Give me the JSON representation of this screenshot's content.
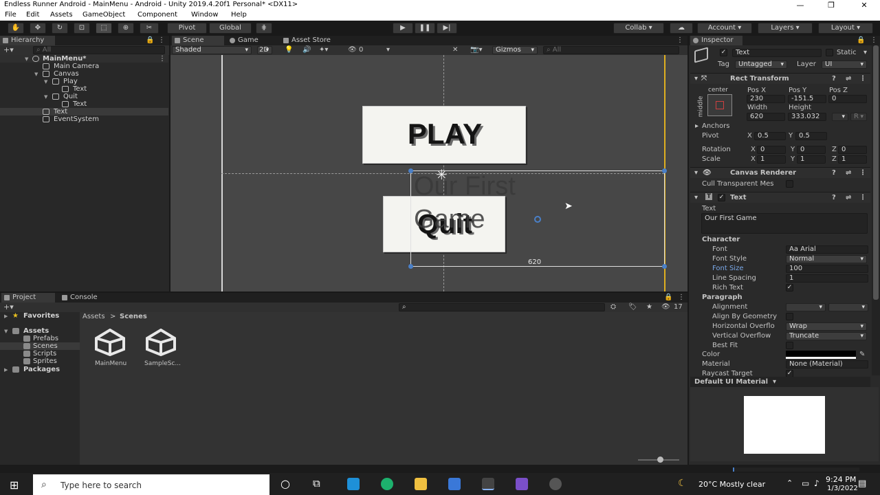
{
  "window": {
    "title": "Endless Runner Android - MainMenu - Android - Unity 2019.4.20f1 Personal* <DX11>",
    "minimize": "—",
    "maximize": "❐",
    "close": "✕"
  },
  "menu": [
    "File",
    "Edit",
    "Assets",
    "GameObject",
    "Component",
    "Window",
    "Help"
  ],
  "toolbar": {
    "pivot": "Pivot",
    "global": "Global",
    "collab": "Collab",
    "account": "Account",
    "layers": "Layers",
    "layout": "Layout"
  },
  "hierarchy": {
    "tab": "Hierarchy",
    "search": "All",
    "items": [
      {
        "label": "MainMenu*",
        "depth": 0,
        "scene": true
      },
      {
        "label": "Main Camera",
        "depth": 1
      },
      {
        "label": "Canvas",
        "depth": 1
      },
      {
        "label": "Play",
        "depth": 2
      },
      {
        "label": "Text",
        "depth": 3
      },
      {
        "label": "Quit",
        "depth": 2
      },
      {
        "label": "Text",
        "depth": 3
      },
      {
        "label": "Text",
        "depth": 2,
        "selected": true
      },
      {
        "label": "EventSystem",
        "depth": 1
      }
    ]
  },
  "scene": {
    "tabs": [
      "Scene",
      "Game",
      "Asset Store"
    ],
    "shading": "Shaded",
    "mode2d": "2D",
    "hidden_count": "0",
    "gizmos": "Gizmos",
    "search": "All",
    "play_label": "PLAY",
    "quit_label": "Quit",
    "text_label": "Our First Game",
    "width_label": "620"
  },
  "project": {
    "tabs": [
      "Project",
      "Console"
    ],
    "hidden_count": "17",
    "favorites": "Favorites",
    "assets": "Assets",
    "folders": [
      "Prefabs",
      "Scenes",
      "Scripts",
      "Sprites"
    ],
    "packages": "Packages",
    "breadcrumb": [
      "Assets",
      "Scenes"
    ],
    "files": [
      "MainMenu",
      "SampleSc..."
    ]
  },
  "inspector": {
    "tab": "Inspector",
    "object_name": "Text",
    "static": "Static",
    "tag_label": "Tag",
    "tag": "Untagged",
    "layer_label": "Layer",
    "layer": "UI",
    "rect": {
      "title": "Rect Transform",
      "anchor_h": "center",
      "anchor_v": "middle",
      "posx_label": "Pos X",
      "posy_label": "Pos Y",
      "posz_label": "Pos Z",
      "posx": "230",
      "posy": "-151.5",
      "posz": "0",
      "width_label": "Width",
      "height_label": "Height",
      "width": "620",
      "height": "333.032",
      "r_label": "R",
      "anchors": "Anchors",
      "pivot": "Pivot",
      "pivot_x": "0.5",
      "pivot_y": "0.5",
      "rotation": "Rotation",
      "rot_x": "0",
      "rot_y": "0",
      "rot_z": "0",
      "scale": "Scale",
      "sc_x": "1",
      "sc_y": "1",
      "sc_z": "1"
    },
    "canvas_renderer": {
      "title": "Canvas Renderer",
      "cull": "Cull Transparent Mes"
    },
    "text": {
      "title": "Text",
      "text_label": "Text",
      "value": "Our First Game",
      "character": "Character",
      "font_label": "Font",
      "font": "Arial",
      "font_style_label": "Font Style",
      "font_style": "Normal",
      "font_size_label": "Font Size",
      "font_size": "100",
      "line_spacing_label": "Line Spacing",
      "line_spacing": "1",
      "rich_text_label": "Rich Text",
      "paragraph": "Paragraph",
      "alignment_label": "Alignment",
      "align_geom_label": "Align By Geometry",
      "hoverflow_label": "Horizontal Overflo",
      "hoverflow": "Wrap",
      "voverflow_label": "Vertical Overflow",
      "voverflow": "Truncate",
      "bestfit_label": "Best Fit",
      "color_label": "Color",
      "material_label": "Material",
      "material": "None (Material)",
      "raycast_label": "Raycast Target"
    },
    "material_preview": "Default UI Material"
  },
  "taskbar": {
    "search": "Type here to search",
    "weather": "20°C  Mostly clear",
    "time": "9:24 PM",
    "date": "1/3/2022"
  },
  "colors": {
    "accent": "#4a80c8",
    "selection": "#2c5d87",
    "gizmo_yellow": "#e0b020"
  }
}
